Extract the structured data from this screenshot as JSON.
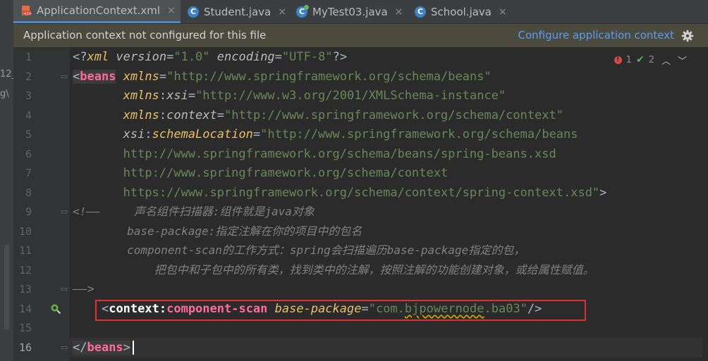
{
  "tabs": [
    {
      "label": "ApplicationContext.xml",
      "icon": "xml-file-icon",
      "active": true
    },
    {
      "label": "Student.java",
      "icon": "java-class-icon",
      "active": false
    },
    {
      "label": "MyTest03.java",
      "icon": "java-class-run-icon",
      "active": false
    },
    {
      "label": "School.java",
      "icon": "java-class-icon",
      "active": false
    }
  ],
  "close_glyph": "×",
  "notice": {
    "message": "Application context not configured for this file",
    "link": "Configure application context"
  },
  "inspection": {
    "errors": "1",
    "warnings": "2"
  },
  "left_fragments": {
    "f1": "12_",
    "f2": "g\\"
  },
  "gutter": {
    "line_numbers": [
      "1",
      "2",
      "3",
      "4",
      "5",
      "6",
      "7",
      "8",
      "9",
      "10",
      "11",
      "12",
      "13",
      "14",
      "15",
      "16"
    ]
  },
  "code": {
    "l1": {
      "a": "<?",
      "b": "xml ",
      "c": "version",
      "d": "=",
      "e": "\"1.0\"",
      "f": " ",
      "g": "encoding",
      "h": "=",
      "i": "\"UTF-8\"",
      "j": "?>"
    },
    "l2": {
      "a": "<",
      "b": "beans",
      "c": " ",
      "d": "xmlns",
      "e": "=",
      "f": "\"http://www.springframework.org/schema/beans\""
    },
    "l3": {
      "pad": "       ",
      "a": "xmlns",
      "b": ":",
      "c": "xsi",
      "d": "=",
      "e": "\"http://www.w3.org/2001/XMLSchema-instance\""
    },
    "l4": {
      "pad": "       ",
      "a": "xmlns",
      "b": ":",
      "c": "context",
      "d": "=",
      "e": "\"http://www.springframework.org/schema/context\""
    },
    "l5": {
      "pad": "       ",
      "a": "xsi",
      "b": ":",
      "c": "schemaLocation",
      "d": "=",
      "e": "\"http://www.springframework.org/schema/beans"
    },
    "l6": {
      "pad": "       ",
      "a": "http://www.springframework.org/schema/beans/spring-beans.xsd"
    },
    "l7": {
      "pad": "       ",
      "a": "http://www.springframework.org/schema/context"
    },
    "l8": {
      "pad": "       ",
      "a": "https://www.springframework.org/schema/context/spring-context.xsd\"",
      "b": ">"
    },
    "l9": {
      "a": "<!—— ",
      "b": "    声名组件扫描器:组件就是java对象"
    },
    "l10": {
      "a": "        base-package:指定注解在你的项目中的包名"
    },
    "l11": {
      "a": "        component-scan的工作方式：spring会扫描遍历base-package指定的包，"
    },
    "l12": {
      "a": "            把包中和子包中的所有类，找到类中的注解，按照注解的功能创建对象，或给属性赋值。"
    },
    "l13": {
      "a": "——>"
    },
    "l14": {
      "pad": "    ",
      "a": "<",
      "b": "context",
      "c": ":",
      "d": "component-scan",
      "e": " ",
      "f": "base-package",
      "g": "=",
      "h": "\"com.",
      "i": "bjpowernode",
      "j": ".ba03\"",
      "k": "/>"
    },
    "l16": {
      "a": "</",
      "b": "beans",
      "c": ">"
    }
  },
  "colors": {
    "accent": "#4a88c7",
    "link": "#589df6",
    "highlight_box": "#e03030",
    "notice_bg": "#4b4a3d"
  }
}
